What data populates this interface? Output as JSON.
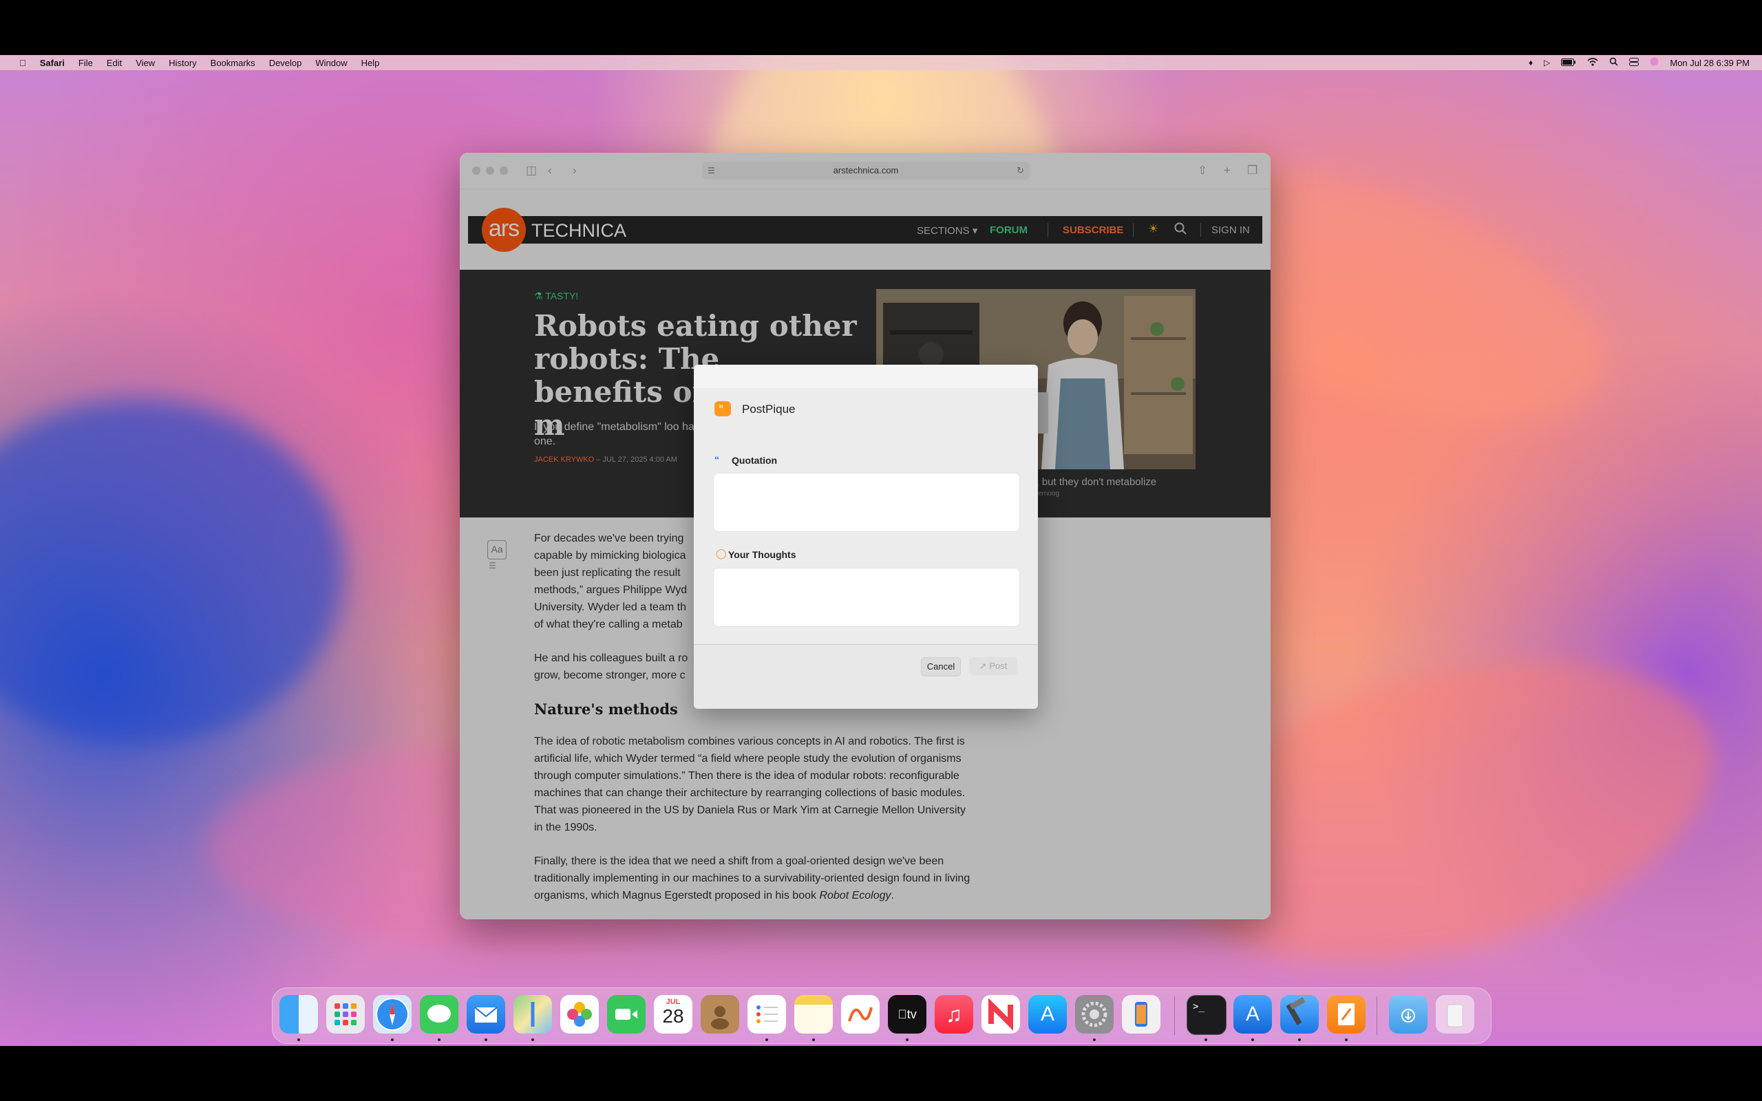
{
  "menubar": {
    "app": "Safari",
    "items": [
      "File",
      "Edit",
      "View",
      "History",
      "Bookmarks",
      "Develop",
      "Window",
      "Help"
    ],
    "clock": "Mon Jul 28  6:39 PM"
  },
  "browser": {
    "url": "arstechnica.com"
  },
  "site": {
    "logo_short": "ars",
    "logo_word": "TECHNICA",
    "nav": {
      "sections": "SECTIONS",
      "forum": "FORUM",
      "subscribe": "SUBSCRIBE",
      "signin": "SIGN IN"
    },
    "kicker": "TASTY!",
    "headline": "Robots eating other robots: The benefits of machine m",
    "dek": "If you define \"metabolism\" loo have one.",
    "byline_author": "JACEK KRYWKO",
    "byline_date": " – JUL 27, 2025 4:00 AM",
    "caption": "it, but they don't metabolize",
    "caption_credit": "ernoog"
  },
  "article": {
    "p1": "For decades we've been trying capable by mimicking biologica been just replicating the result methods,” argues Philippe Wyd University. Wyder led a team th of what they're calling a metab",
    "p2": "He and his colleagues built a ro grow, become stronger, more c",
    "h2": "Nature's methods",
    "p3": "The idea of robotic metabolism combines various concepts in AI and robotics. The first is artificial life, which Wyder termed “a field where people study the evolution of organisms through computer simulations.” Then there is the idea of modular robots: reconfigurable machines that can change their architecture by rearranging collections of basic modules. That was pioneered in the US by Daniela Rus or Mark Yim at Carnegie Mellon University in the 1990s.",
    "p4": "Finally, there is the idea that we need a shift from a goal-oriented design we've been traditionally implementing in our machines to a survivability-oriented design found in living organisms, which Magnus Egerstedt proposed in his book ",
    "p4_book": "Robot Ecology",
    "p4_end": "."
  },
  "dialog": {
    "app_name": "PostPique",
    "quotation_label": "Quotation",
    "quotation_value": "",
    "thoughts_label": "Your Thoughts",
    "thoughts_value": "",
    "cancel": "Cancel",
    "post": "Post"
  },
  "dock": {
    "calendar_month": "JUL",
    "calendar_day": "28",
    "apps": [
      "Finder",
      "Launchpad",
      "Safari",
      "Messages",
      "Mail",
      "Maps",
      "Photos",
      "FaceTime",
      "Calendar",
      "Contacts",
      "Reminders",
      "Notes",
      "Freeform",
      "TV",
      "Music",
      "News",
      "App Store",
      "System Settings",
      "iPhone Mirroring",
      "Terminal",
      "Xcode Simulator",
      "Xcode",
      "Pages",
      "Downloads",
      "Trash"
    ]
  },
  "colors": {
    "ars_orange": "#ff4e00",
    "forum_green": "#35d07f",
    "subscribe_orange": "#ff6a2b",
    "dialog_accent": "#ff9a1f"
  }
}
